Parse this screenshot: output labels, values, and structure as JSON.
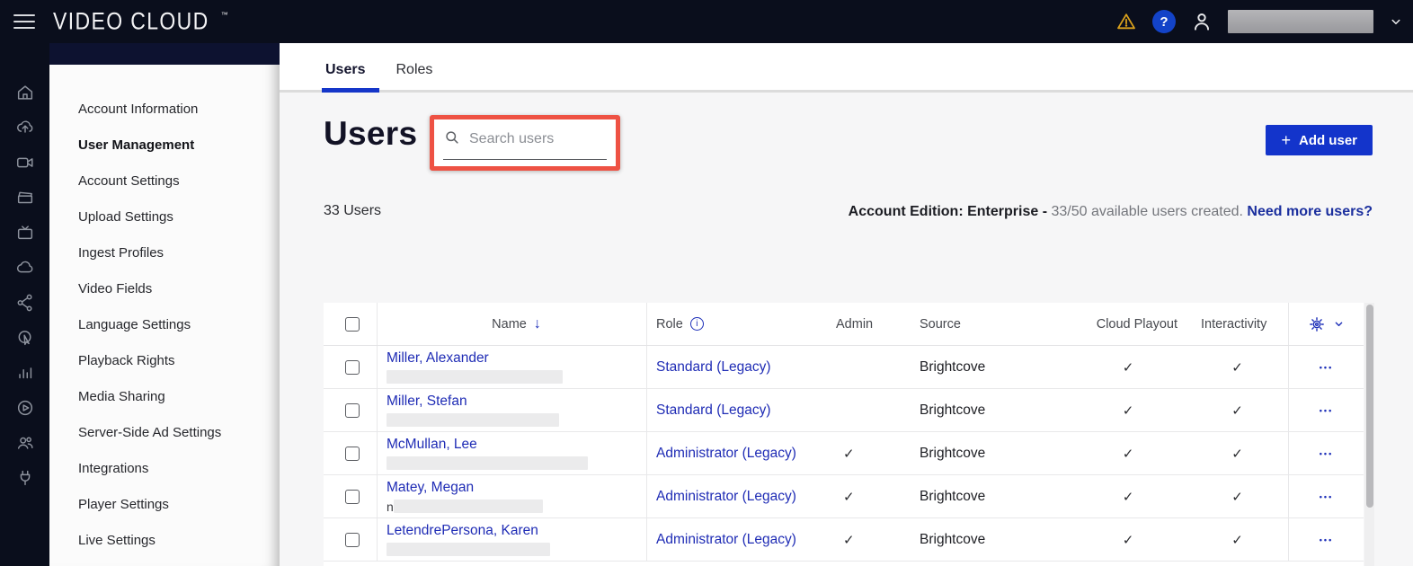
{
  "topbar": {
    "logo": "VIDEO CLOUD",
    "trademark": "™",
    "help_glyph": "?"
  },
  "icon_rail": [
    "home-icon",
    "cloud-upload-icon",
    "video-camera-icon",
    "media-clapperboard-icon",
    "tv-icon",
    "cloud-icon",
    "share-icon",
    "interactivity-icon",
    "analytics-icon",
    "player-icon",
    "users-icon",
    "plug-icon"
  ],
  "sidebar": {
    "items": [
      {
        "label": "Account Information",
        "active": false
      },
      {
        "label": "User Management",
        "active": true
      },
      {
        "label": "Account Settings",
        "active": false
      },
      {
        "label": "Upload Settings",
        "active": false
      },
      {
        "label": "Ingest Profiles",
        "active": false
      },
      {
        "label": "Video Fields",
        "active": false
      },
      {
        "label": "Language Settings",
        "active": false
      },
      {
        "label": "Playback Rights",
        "active": false
      },
      {
        "label": "Media Sharing",
        "active": false
      },
      {
        "label": "Server-Side Ad Settings",
        "active": false
      },
      {
        "label": "Integrations",
        "active": false
      },
      {
        "label": "Player Settings",
        "active": false
      },
      {
        "label": "Live Settings",
        "active": false
      }
    ]
  },
  "tabs": [
    {
      "label": "Users",
      "active": true
    },
    {
      "label": "Roles",
      "active": false
    }
  ],
  "main": {
    "page_title": "Users",
    "search_placeholder": "Search users",
    "user_count": "33 Users",
    "edition_bold": "Account Edition: Enterprise - ",
    "edition_text": "33/50 available users created. ",
    "edition_link": "Need more users?",
    "add_user_plus": "+",
    "add_user_label": "Add user"
  },
  "table": {
    "headers": {
      "name": "Name",
      "role": "Role",
      "admin": "Admin",
      "source": "Source",
      "cloud_playout": "Cloud Playout",
      "interactivity": "Interactivity"
    },
    "sort_icon": "↓",
    "info_icon": "i",
    "check_glyph": "✓",
    "row_menu_glyph": "•••",
    "rows": [
      {
        "name": "Miller, Alexander",
        "email_redacted": true,
        "email_prefix": "",
        "role": "Standard (Legacy)",
        "admin": false,
        "source": "Brightcove",
        "cloud_playout": true,
        "interactivity": true
      },
      {
        "name": "Miller, Stefan",
        "email_redacted": true,
        "email_prefix": "",
        "role": "Standard (Legacy)",
        "admin": false,
        "source": "Brightcove",
        "cloud_playout": true,
        "interactivity": true
      },
      {
        "name": "McMullan, Lee",
        "email_redacted": true,
        "email_prefix": "",
        "role": "Administrator (Legacy)",
        "admin": true,
        "source": "Brightcove",
        "cloud_playout": true,
        "interactivity": true
      },
      {
        "name": "Matey, Megan",
        "email_redacted": true,
        "email_prefix": "n",
        "role": "Administrator (Legacy)",
        "admin": true,
        "source": "Brightcove",
        "cloud_playout": true,
        "interactivity": true
      },
      {
        "name": "LetendrePersona, Karen",
        "email_redacted": true,
        "email_prefix": "",
        "role": "Administrator (Legacy)",
        "admin": true,
        "source": "Brightcove",
        "cloud_playout": true,
        "interactivity": true
      }
    ]
  },
  "colors": {
    "topbar_bg": "#0a0e1c",
    "accent_blue": "#1334cb",
    "link_blue": "#1f2cb5",
    "tab_underline": "#1536c9",
    "annotation_red": "#ee5244",
    "warning_amber": "#d9a01c"
  }
}
